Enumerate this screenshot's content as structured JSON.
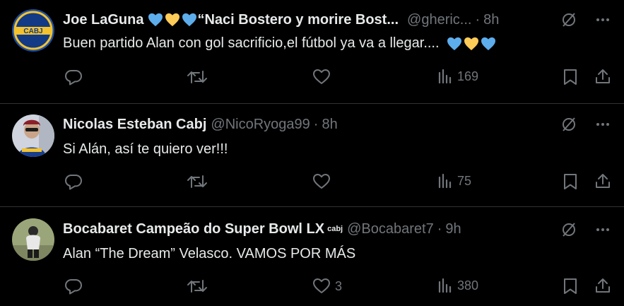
{
  "tweets": [
    {
      "name": "Joe LaGuna",
      "name_suffix": "“Naci Bostero y morire Bost...",
      "handle": "@gheric...",
      "dot": "·",
      "time": "8h",
      "text": "Buen partido Alan con gol sacrificio,el fútbol ya va a llegar....",
      "views": "169",
      "likes": "",
      "badge": "",
      "avatar_text": "CABJ"
    },
    {
      "name": "Nicolas Esteban Cabj",
      "name_suffix": "",
      "handle": "@NicoRyoga99",
      "dot": "·",
      "time": "8h",
      "text": "Si Alán, así te quiero ver!!!",
      "views": "75",
      "likes": "",
      "badge": ""
    },
    {
      "name": "Bocabaret Campeão do Super Bowl LX",
      "name_suffix": "",
      "handle": "@Bocabaret7",
      "dot": "·",
      "time": "9h",
      "text": "Alan “The Dream” Velasco. VAMOS POR MÁS",
      "views": "380",
      "likes": "3",
      "badge": "cabj"
    }
  ],
  "colors": {
    "background": "#000000",
    "text": "#e7e9ea",
    "muted": "#71767b",
    "divider": "#2f3336",
    "blue_heart": "#5dadec",
    "yellow_heart": "#fdcb58"
  },
  "icons": [
    "grok-icon",
    "more-icon",
    "reply-icon",
    "retweet-icon",
    "like-icon",
    "views-icon",
    "bookmark-icon",
    "share-icon",
    "blue-heart-icon",
    "yellow-heart-icon"
  ]
}
